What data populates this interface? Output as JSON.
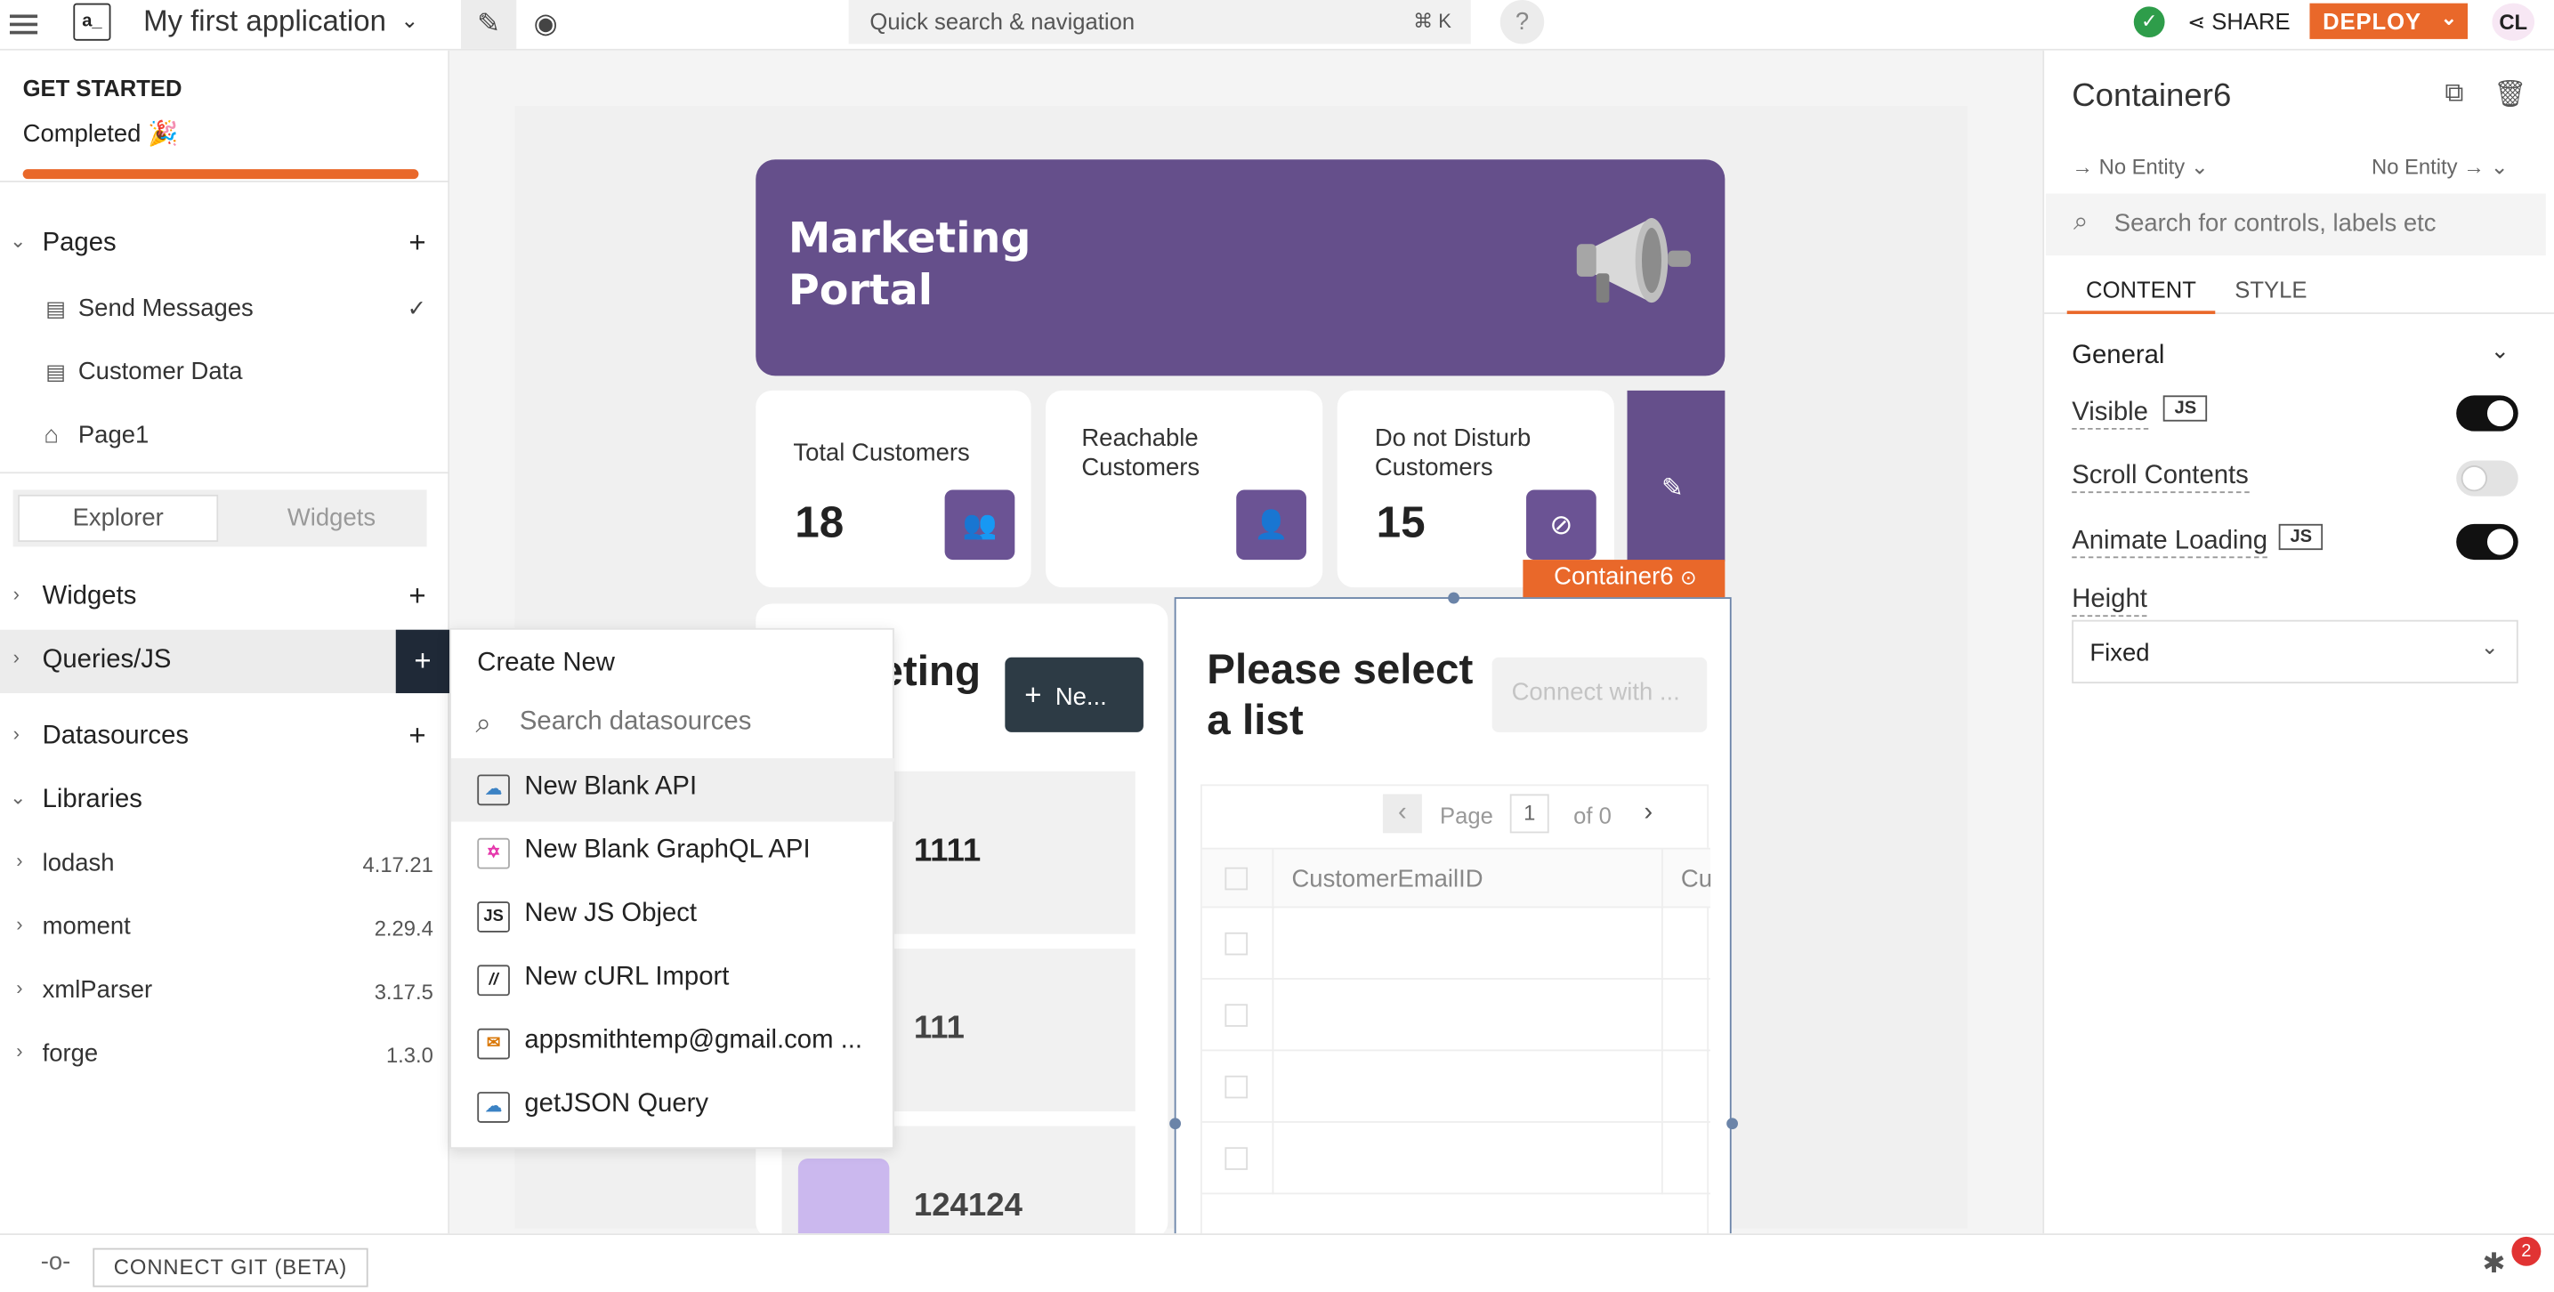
{
  "header": {
    "logo_text": "a_",
    "app_name": "My first application",
    "search_label": "Quick search & navigation",
    "search_shortcut": "⌘ K",
    "help": "?",
    "share": "SHARE",
    "deploy": "DEPLOY",
    "avatar": "CL"
  },
  "onboarding": {
    "title": "GET STARTED",
    "status": "Completed 🎉",
    "progress": 1.0
  },
  "pages": {
    "title": "Pages",
    "items": [
      {
        "label": "Send Messages",
        "selected": true
      },
      {
        "label": "Customer Data"
      },
      {
        "label": "Page1",
        "home": true
      }
    ]
  },
  "sidebar_tabs": {
    "explorer": "Explorer",
    "widgets": "Widgets"
  },
  "explorer": {
    "widgets": "Widgets",
    "queries": "Queries/JS",
    "datasources": "Datasources",
    "libraries": "Libraries",
    "libs": [
      {
        "name": "lodash",
        "version": "4.17.21"
      },
      {
        "name": "moment",
        "version": "2.29.4"
      },
      {
        "name": "xmlParser",
        "version": "3.17.5"
      },
      {
        "name": "forge",
        "version": "1.3.0"
      }
    ]
  },
  "create_menu": {
    "title": "Create New",
    "search_placeholder": "Search datasources",
    "items": [
      {
        "label": "New Blank API",
        "icon": "cloud-icon"
      },
      {
        "label": "New Blank GraphQL API",
        "icon": "graphql-icon"
      },
      {
        "label": "New JS Object",
        "icon": "js-icon",
        "glyph": "JS"
      },
      {
        "label": "New cURL Import",
        "icon": "curl-icon",
        "glyph": "//"
      },
      {
        "label": "appsmithtemp@gmail.com ...",
        "icon": "email-datasource-icon"
      },
      {
        "label": "getJSON Query",
        "icon": "cloud-icon"
      }
    ]
  },
  "canvas": {
    "hero_title_line1": "Marketing",
    "hero_title_line2": "Portal",
    "stats": [
      {
        "label": "Total Customers",
        "value": "18"
      },
      {
        "label": "Reachable Customers",
        "value": ""
      },
      {
        "label": "Do not Disturb Customers",
        "value": "15"
      }
    ],
    "container_tag": "Container6",
    "list_partial_title": "eting",
    "new_button": "Ne...",
    "list_items": [
      "1111",
      "111",
      "124124"
    ],
    "select_title_line1": "Please select",
    "select_title_line2": "a list",
    "connect_button": "Connect with ...",
    "pagination": {
      "page_label": "Page",
      "page": "1",
      "of": "of 0"
    },
    "table_columns": [
      "CustomerEmailID",
      "Cu"
    ]
  },
  "properties": {
    "widget_name": "Container6",
    "entity_left": "No Entity",
    "entity_right": "No Entity",
    "search_placeholder": "Search for controls, labels etc",
    "tabs": [
      "CONTENT",
      "STYLE"
    ],
    "section": "General",
    "visible": "Visible",
    "scroll": "Scroll Contents",
    "animate": "Animate Loading",
    "js": "JS",
    "height_label": "Height",
    "height_value": "Fixed"
  },
  "footer": {
    "connect_git": "CONNECT GIT (BETA)",
    "bug_count": "2"
  }
}
